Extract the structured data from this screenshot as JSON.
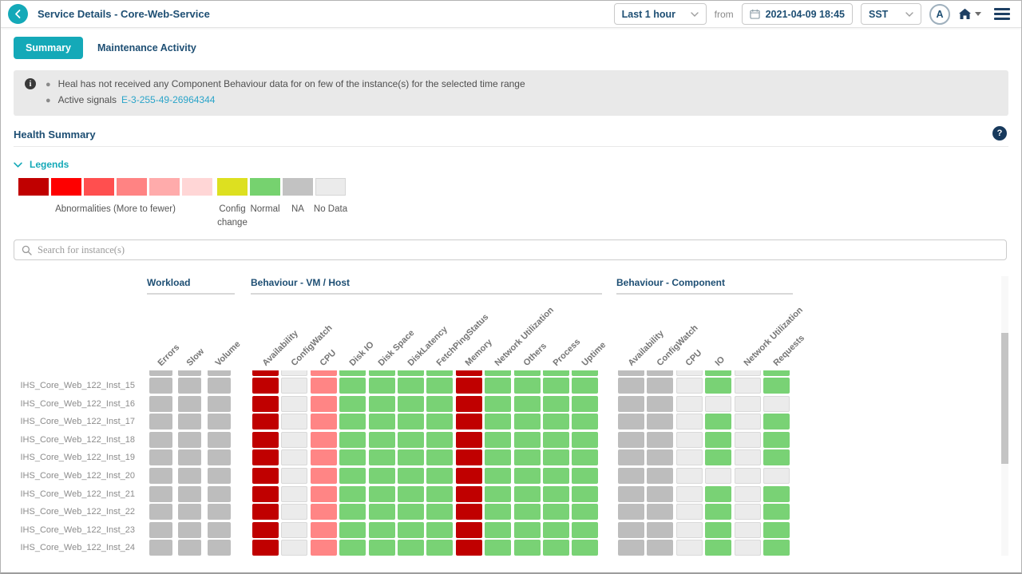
{
  "header": {
    "title": "Service Details - Core-Web-Service",
    "time_range": "Last 1 hour",
    "from_label": "from",
    "datetime": "2021-04-09 18:45",
    "timezone": "SST",
    "avatar_initial": "A"
  },
  "tabs": [
    {
      "label": "Summary",
      "active": true
    },
    {
      "label": "Maintenance Activity",
      "active": false
    }
  ],
  "notices": {
    "line1": "Heal has not received any Component Behaviour data for on few of the instance(s) for the selected time range",
    "line2_label": "Active signals",
    "line2_link": "E-3-255-49-26964344"
  },
  "section_title": "Health Summary",
  "help_glyph": "?",
  "legends": {
    "title": "Legends",
    "red_swatches": [
      "#c00000",
      "#fe0000",
      "#ff4f4f",
      "#ff8383",
      "#ffabab",
      "#ffd6d6"
    ],
    "red_label": "Abnormalities (More to fewer)",
    "items": [
      {
        "color": "#dde020",
        "label": "Config change",
        "bordered": false
      },
      {
        "color": "#76d26f",
        "label": "Normal",
        "bordered": false
      },
      {
        "color": "#c2c2c2",
        "label": "NA",
        "bordered": false
      },
      {
        "color": "#ebebeb",
        "label": "No Data",
        "bordered": true
      }
    ]
  },
  "search": {
    "placeholder": "Search for instance(s)"
  },
  "heatmap": {
    "groups": [
      {
        "name": "Workload",
        "columns": [
          "Errors",
          "Slow",
          "Volume"
        ]
      },
      {
        "name": "Behaviour - VM / Host",
        "columns": [
          "Availability",
          "ConfigWatch",
          "CPU",
          "Disk IO",
          "Disk Space",
          "DiskLatency",
          "FetchPingStatus",
          "Memory",
          "Network Utilization",
          "Others",
          "Process",
          "Uptime"
        ]
      },
      {
        "name": "Behaviour - Component",
        "columns": [
          "Availability",
          "ConfigWatch",
          "CPU",
          "IO",
          "Network Utilization",
          "Requests"
        ]
      }
    ],
    "cell_colors": {
      "na": "#bdbdbd",
      "nodata": "#ebebeb",
      "abn_high": "#c00000",
      "abn_mid": "#ff8585",
      "normal": "#79d275"
    },
    "top_partial_row": {
      "cells": [
        "na",
        "na",
        "na",
        "abn_high",
        "nodata",
        "abn_mid",
        "normal",
        "normal",
        "normal",
        "normal",
        "abn_high",
        "normal",
        "normal",
        "normal",
        "normal",
        "na",
        "na",
        "nodata",
        "normal",
        "nodata",
        "normal"
      ]
    },
    "rows": [
      {
        "label": "IHS_Core_Web_122_Inst_15",
        "cells": [
          "na",
          "na",
          "na",
          "abn_high",
          "nodata",
          "abn_mid",
          "normal",
          "normal",
          "normal",
          "normal",
          "abn_high",
          "normal",
          "normal",
          "normal",
          "normal",
          "na",
          "na",
          "nodata",
          "normal",
          "nodata",
          "normal"
        ]
      },
      {
        "label": "IHS_Core_Web_122_Inst_16",
        "cells": [
          "na",
          "na",
          "na",
          "abn_high",
          "nodata",
          "abn_mid",
          "normal",
          "normal",
          "normal",
          "normal",
          "abn_high",
          "normal",
          "normal",
          "normal",
          "normal",
          "na",
          "na",
          "nodata",
          "nodata",
          "nodata",
          "nodata"
        ]
      },
      {
        "label": "IHS_Core_Web_122_Inst_17",
        "cells": [
          "na",
          "na",
          "na",
          "abn_high",
          "nodata",
          "abn_mid",
          "normal",
          "normal",
          "normal",
          "normal",
          "abn_high",
          "normal",
          "normal",
          "normal",
          "normal",
          "na",
          "na",
          "nodata",
          "normal",
          "nodata",
          "normal"
        ]
      },
      {
        "label": "IHS_Core_Web_122_Inst_18",
        "cells": [
          "na",
          "na",
          "na",
          "abn_high",
          "nodata",
          "abn_mid",
          "normal",
          "normal",
          "normal",
          "normal",
          "abn_high",
          "normal",
          "normal",
          "normal",
          "normal",
          "na",
          "na",
          "nodata",
          "normal",
          "nodata",
          "normal"
        ]
      },
      {
        "label": "IHS_Core_Web_122_Inst_19",
        "cells": [
          "na",
          "na",
          "na",
          "abn_high",
          "nodata",
          "abn_mid",
          "normal",
          "normal",
          "normal",
          "normal",
          "abn_high",
          "normal",
          "normal",
          "normal",
          "normal",
          "na",
          "na",
          "nodata",
          "normal",
          "nodata",
          "normal"
        ]
      },
      {
        "label": "IHS_Core_Web_122_Inst_20",
        "cells": [
          "na",
          "na",
          "na",
          "abn_high",
          "nodata",
          "abn_mid",
          "normal",
          "normal",
          "normal",
          "normal",
          "abn_high",
          "normal",
          "normal",
          "normal",
          "normal",
          "na",
          "na",
          "nodata",
          "nodata",
          "nodata",
          "nodata"
        ]
      },
      {
        "label": "IHS_Core_Web_122_Inst_21",
        "cells": [
          "na",
          "na",
          "na",
          "abn_high",
          "nodata",
          "abn_mid",
          "normal",
          "normal",
          "normal",
          "normal",
          "abn_high",
          "normal",
          "normal",
          "normal",
          "normal",
          "na",
          "na",
          "nodata",
          "normal",
          "nodata",
          "normal"
        ]
      },
      {
        "label": "IHS_Core_Web_122_Inst_22",
        "cells": [
          "na",
          "na",
          "na",
          "abn_high",
          "nodata",
          "abn_mid",
          "normal",
          "normal",
          "normal",
          "normal",
          "abn_high",
          "normal",
          "normal",
          "normal",
          "normal",
          "na",
          "na",
          "nodata",
          "normal",
          "nodata",
          "normal"
        ]
      },
      {
        "label": "IHS_Core_Web_122_Inst_23",
        "cells": [
          "na",
          "na",
          "na",
          "abn_high",
          "nodata",
          "abn_mid",
          "normal",
          "normal",
          "normal",
          "normal",
          "abn_high",
          "normal",
          "normal",
          "normal",
          "normal",
          "na",
          "na",
          "nodata",
          "normal",
          "nodata",
          "normal"
        ]
      },
      {
        "label": "IHS_Core_Web_122_Inst_24",
        "cells": [
          "na",
          "na",
          "na",
          "abn_high",
          "nodata",
          "abn_mid",
          "normal",
          "normal",
          "normal",
          "normal",
          "abn_high",
          "normal",
          "normal",
          "normal",
          "normal",
          "na",
          "na",
          "nodata",
          "normal",
          "nodata",
          "normal"
        ]
      }
    ]
  },
  "colors": {
    "accent_teal": "#14a9b8",
    "navy_text": "#1d4e73",
    "link_blue": "#2aa4c9"
  }
}
